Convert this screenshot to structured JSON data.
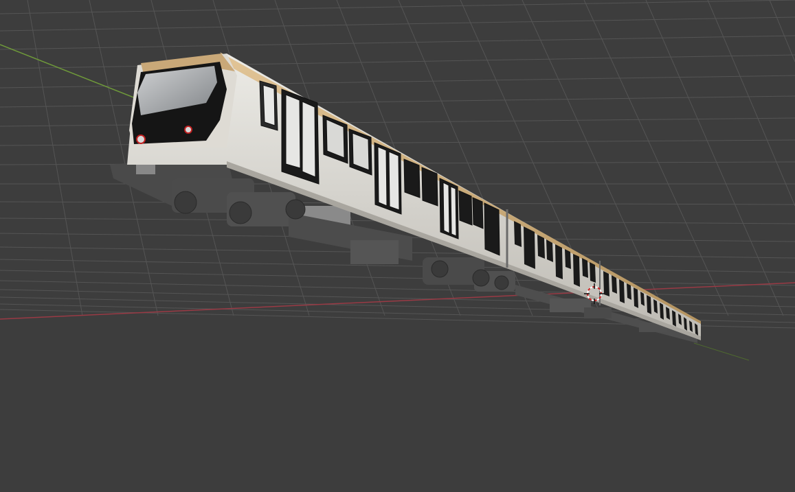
{
  "viewport": {
    "view": "3D Viewport",
    "shading": "solid",
    "background_color": "#3d3d3d",
    "grid_color": "#555555",
    "x_axis_color": "#9a3a45",
    "y_axis_color": "#6f9a3a"
  },
  "scene_object": {
    "name": "metro-train",
    "cars": 3,
    "body_color": "#d9d6cf",
    "roof_stripe_color": "#c9a878",
    "window_color": "#1a1a1a",
    "undercarriage_color": "#5a5a5a"
  },
  "cursor_3d": {
    "colors": [
      "#d02020",
      "#ffffff"
    ]
  }
}
